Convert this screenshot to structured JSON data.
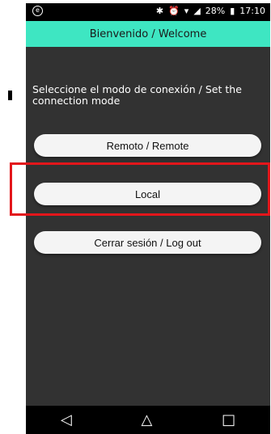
{
  "status_bar": {
    "left_icon": "e",
    "icons": [
      "bluetooth-icon",
      "alarm-icon",
      "wifi-icon",
      "signal-icon"
    ],
    "battery": "28%",
    "time": "17:10"
  },
  "header": {
    "title": "Bienvenido / Welcome",
    "color": "#3ee6c2"
  },
  "prompt": "Seleccione el modo de conexión / Set the connection mode",
  "buttons": {
    "remote": "Remoto / Remote",
    "local": "Local",
    "logout": "Cerrar sesión / Log out"
  },
  "nav": {
    "back": "◁",
    "home": "△",
    "recents": "□"
  },
  "annotation": {
    "highlight_color": "#e3161b"
  }
}
